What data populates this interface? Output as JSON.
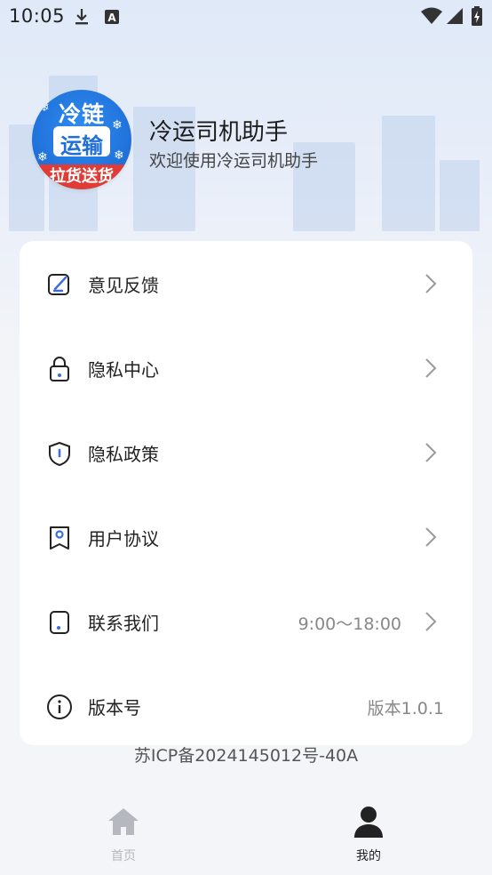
{
  "status_bar": {
    "time": "10:05"
  },
  "profile": {
    "avatar_text": [
      "冷链",
      "运输",
      "拉货送货"
    ],
    "app_name": "冷运司机助手",
    "welcome": "欢迎使用冷运司机助手"
  },
  "menu": [
    {
      "label": "意见反馈",
      "icon": "feedback-icon",
      "value": "",
      "chevron": true
    },
    {
      "label": "隐私中心",
      "icon": "lock-icon",
      "value": "",
      "chevron": true
    },
    {
      "label": "隐私政策",
      "icon": "shield-icon",
      "value": "",
      "chevron": true
    },
    {
      "label": "用户协议",
      "icon": "bookmark-user-icon",
      "value": "",
      "chevron": true
    },
    {
      "label": "联系我们",
      "icon": "phone-icon",
      "value": "9:00～18:00",
      "chevron": true
    },
    {
      "label": "版本号",
      "icon": "info-icon",
      "value": "版本1.0.1",
      "chevron": false
    }
  ],
  "icp": "苏ICP备2024145012号-40A",
  "nav": [
    {
      "label": "首页",
      "icon": "home-icon",
      "active": false
    },
    {
      "label": "我的",
      "icon": "user-icon",
      "active": true
    }
  ],
  "colors": {
    "active": "#222222",
    "inactive": "#b5b8bf",
    "avatar_blue": "#1f6fd8",
    "avatar_red": "#e23a34"
  }
}
